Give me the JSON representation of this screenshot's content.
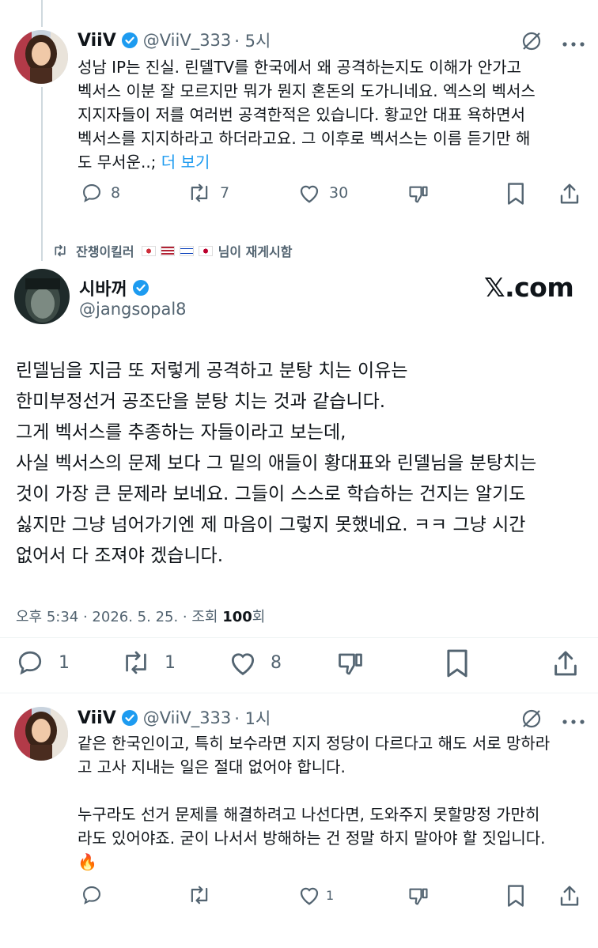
{
  "tweet1": {
    "name": "ViiV",
    "handle": "@ViiV_333",
    "time": "· 5시",
    "lines": [
      "성남 IP는 진실. 린델TV를 한국에서 왜 공격하는지도 이해가 안가고",
      "벡서스 이분 잘 모르지만 뭐가 뭔지 혼돈의 도가니네요. 엑스의 벡서스",
      "지지자들이 저를 여러번 공격한적은 있습니다. 황교안 대표 욕하면서",
      "벡서스를 지지하라고 하더라고요. 그 이후로 벡서스는 이름 듣기만 해",
      "도 무서운..;"
    ],
    "more": "더 보기",
    "replies": "8",
    "reposts": "7",
    "likes": "30"
  },
  "repost_banner": {
    "user": "잔챙이킬러",
    "suffix": "님이 재게시함"
  },
  "main_tweet": {
    "name": "시바꺼",
    "handle": "@jangsopal8",
    "brand": "𝕏.com",
    "lines": [
      "린델님을 지금 또 저렇게 공격하고 분탕 치는 이유는",
      "한미부정선거 공조단을 분탕 치는 것과 같습니다.",
      "그게 벡서스를 추종하는 자들이라고 보는데,",
      "사실 벡서스의 문제 보다 그 밑의 애들이 황대표와 린델님을 분탕치는",
      "것이 가장 큰 문제라 보네요. 그들이 스스로 학습하는 건지는 알기도",
      "싫지만 그냥 넘어가기엔 제 마음이 그렇지 못했네요. ㅋㅋ 그냥 시간",
      "없어서 다 조져야 겠습니다."
    ],
    "meta_prefix": "오후 5:34 · 2026. 5. 25. · 조회 ",
    "views": "100",
    "views_suffix": "회",
    "replies": "1",
    "reposts": "1",
    "likes": "8"
  },
  "tweet3": {
    "name": "ViiV",
    "handle": "@ViiV_333",
    "time": "· 1시",
    "lines": [
      "같은 한국인이고, 특히 보수라면 지지 정당이 다르다고 해도 서로 망하라",
      "고 고사 지내는 일은 절대 없어야 합니다.",
      "",
      "누구라도 선거 문제를 해결하려고 나선다면, 도와주지 못할망정 가만히",
      "라도 있어야죠. 굳이 나서서 방해하는 건 정말 하지 말아야 할 짓입니다.",
      "🔥"
    ],
    "likes": "1"
  },
  "colors": {
    "verified": "#1d9bf0",
    "secondary": "#536471",
    "text": "#0f1419"
  }
}
